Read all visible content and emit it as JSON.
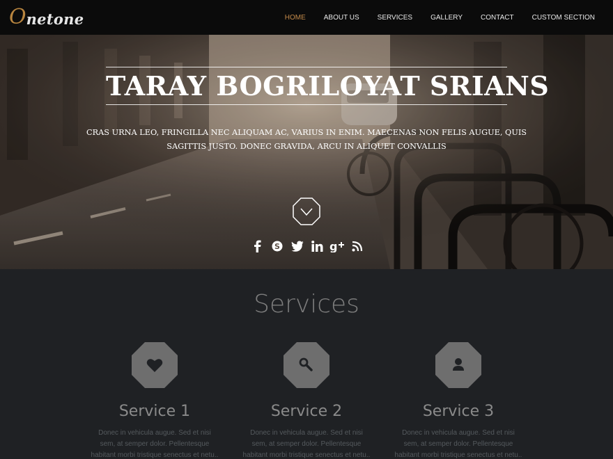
{
  "brand": {
    "logo_first": "O",
    "logo_rest": "netone"
  },
  "nav": {
    "items": [
      {
        "label": "HOME"
      },
      {
        "label": "ABOUT US"
      },
      {
        "label": "SERVICES"
      },
      {
        "label": "GALLERY"
      },
      {
        "label": "CONTACT"
      },
      {
        "label": "CUSTOM SECTION"
      }
    ],
    "active": "HOME"
  },
  "hero": {
    "title": "TARAY BOGRILOYAT SRIANS",
    "subtitle": "CRAS URNA LEO, FRINGILLA NEC ALIQUAM AC, VARIUS IN ENIM. MAECENAS NON FELIS AUGUE, QUIS SAGITTIS JUSTO. DONEC GRAVIDA, ARCU IN ALIQUET CONVALLIS",
    "social": [
      "facebook-icon",
      "skype-icon",
      "twitter-icon",
      "linkedin-icon",
      "google-plus-icon",
      "rss-icon"
    ]
  },
  "services": {
    "title": "Services",
    "items": [
      {
        "name": "Service 1",
        "icon": "heart-icon",
        "desc": "Donec in vehicula augue. Sed et nisi sem, at semper dolor. Pellentesque habitant morbi tristique senectus et netu.."
      },
      {
        "name": "Service 2",
        "icon": "search-icon",
        "desc": "Donec in vehicula augue. Sed et nisi sem, at semper dolor. Pellentesque habitant morbi tristique senectus et netu.."
      },
      {
        "name": "Service 3",
        "icon": "user-icon",
        "desc": "Donec in vehicula augue. Sed et nisi sem, at semper dolor. Pellentesque habitant morbi tristique senectus et netu.."
      }
    ]
  },
  "colors": {
    "accent": "#c48b4a",
    "navbar": "#0b0b0b",
    "services_bg": "#1f2124",
    "octagon": "#6e6e6e"
  }
}
